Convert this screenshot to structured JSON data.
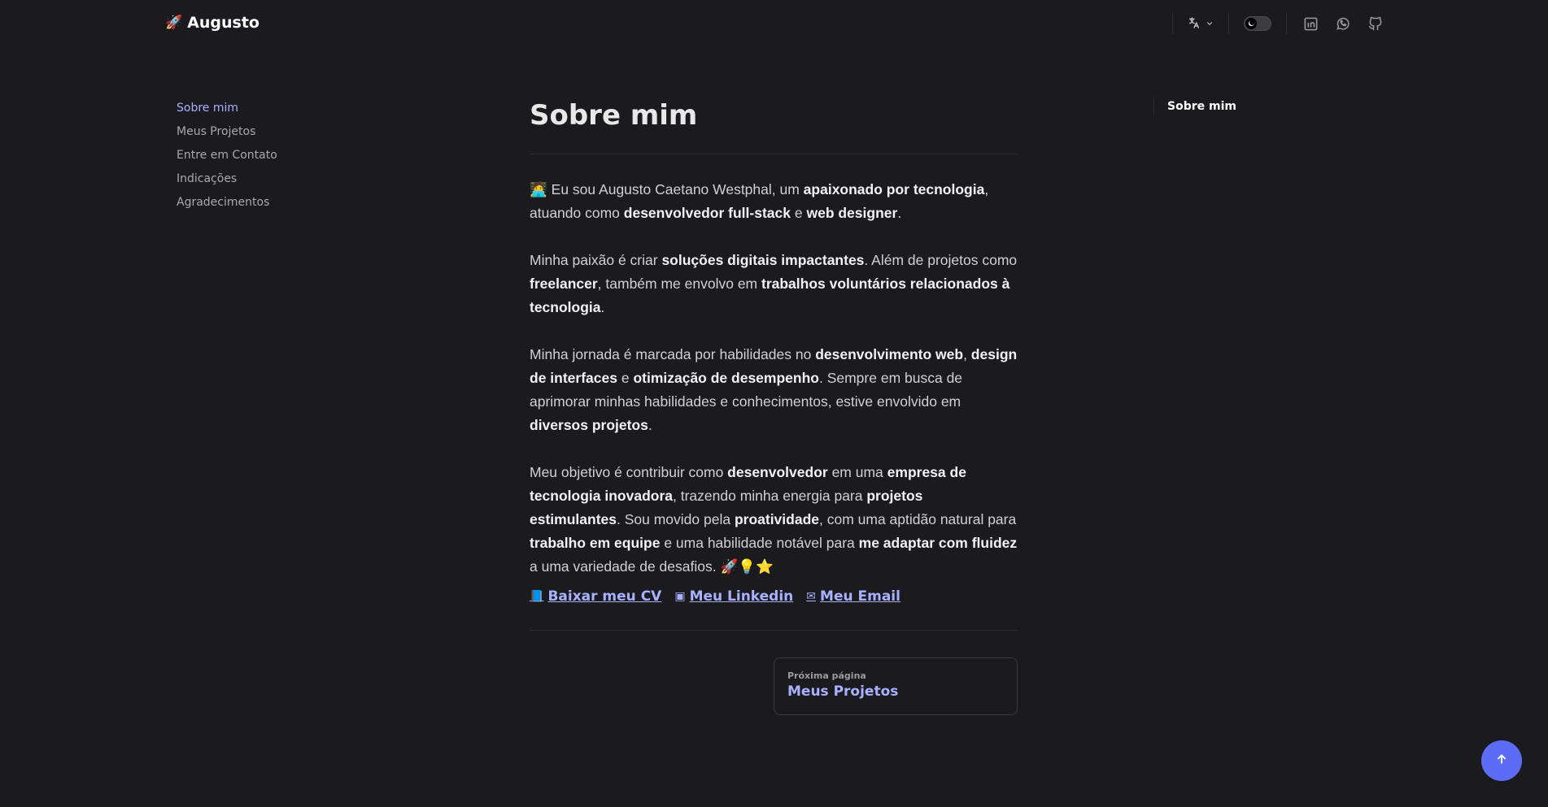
{
  "header": {
    "logo_glyph": "🚀",
    "brand_name": "Augusto",
    "language_icon": "translate-icon",
    "theme_toggle_icon": "moon-icon",
    "social_icons": [
      "linkedin-icon",
      "whatsapp-icon",
      "github-icon"
    ]
  },
  "sidebar": {
    "items": [
      {
        "label": "Sobre mim"
      },
      {
        "label": "Meus Projetos"
      },
      {
        "label": "Entre em Contato"
      },
      {
        "label": "Indicações"
      },
      {
        "label": "Agradecimentos"
      }
    ]
  },
  "outline": {
    "item": "Sobre mim"
  },
  "main": {
    "title": "Sobre mim",
    "p1": {
      "emoji": "🧑‍💻",
      "t1": " Eu sou Augusto Caetano Westphal, um ",
      "b1": "apaixonado por tecnologia",
      "t2": ", atuando como ",
      "b2": "desenvolvedor full-stack",
      "t3": " e ",
      "b3": "web designer",
      "t4": "."
    },
    "p2": {
      "t1": "Minha paixão é criar ",
      "b1": "soluções digitais impactantes",
      "t2": ". Além de projetos como ",
      "b2": "freelancer",
      "t3": ", também me envolvo em ",
      "b3": "trabalhos voluntários relacionados à tecnologia",
      "t4": "."
    },
    "p3": {
      "t1": "Minha jornada é marcada por habilidades no ",
      "b1": "desenvolvimento web",
      "t2": ", ",
      "b2": "design de interfaces",
      "t3": " e ",
      "b3": "otimização de desempenho",
      "t4": ". Sempre em busca de aprimorar minhas habilidades e conhecimentos, estive envolvido em ",
      "b4": "diversos projetos",
      "t5": "."
    },
    "p4": {
      "t1": "Meu objetivo é contribuir como ",
      "b1": "desenvolvedor",
      "t2": " em uma ",
      "b2": "empresa de tecnologia inovadora",
      "t3": ", trazendo minha energia para ",
      "b3": "projetos estimulantes",
      "t4": ". Sou movido pela ",
      "b4": "proatividade",
      "t5": ", com uma aptidão natural para ",
      "b5": "trabalho em equipe",
      "t6": " e uma habilidade notável para ",
      "b6": "me adaptar com fluidez",
      "t7": " a uma variedade de desafios. ",
      "emojis": "🚀💡⭐"
    },
    "links": [
      {
        "icon_glyph": "📘",
        "label": "Baixar meu CV"
      },
      {
        "icon_glyph": "▣",
        "label": "Meu Linkedin"
      },
      {
        "icon_glyph": "✉",
        "label": "Meu Email"
      }
    ],
    "next": {
      "desc": "Próxima página",
      "title": "Meus Projetos"
    }
  },
  "colors": {
    "background": "#1b1b1f",
    "accent": "#a8b1ff",
    "back_to_top": "#5c6cf5"
  },
  "back_to_top_icon": "arrow-up-icon"
}
